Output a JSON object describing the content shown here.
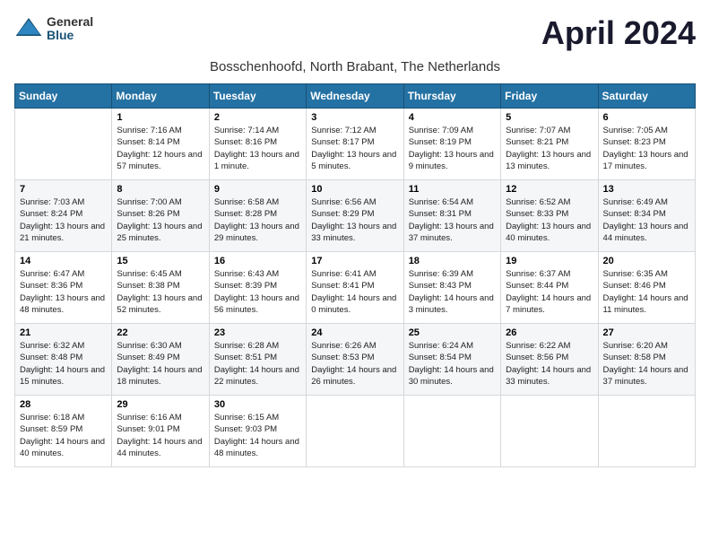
{
  "logo": {
    "general": "General",
    "blue": "Blue"
  },
  "title": "April 2024",
  "subtitle": "Bosschenhoofd, North Brabant, The Netherlands",
  "days_of_week": [
    "Sunday",
    "Monday",
    "Tuesday",
    "Wednesday",
    "Thursday",
    "Friday",
    "Saturday"
  ],
  "weeks": [
    [
      {
        "day": "",
        "sunrise": "",
        "sunset": "",
        "daylight": ""
      },
      {
        "day": "1",
        "sunrise": "Sunrise: 7:16 AM",
        "sunset": "Sunset: 8:14 PM",
        "daylight": "Daylight: 12 hours and 57 minutes."
      },
      {
        "day": "2",
        "sunrise": "Sunrise: 7:14 AM",
        "sunset": "Sunset: 8:16 PM",
        "daylight": "Daylight: 13 hours and 1 minute."
      },
      {
        "day": "3",
        "sunrise": "Sunrise: 7:12 AM",
        "sunset": "Sunset: 8:17 PM",
        "daylight": "Daylight: 13 hours and 5 minutes."
      },
      {
        "day": "4",
        "sunrise": "Sunrise: 7:09 AM",
        "sunset": "Sunset: 8:19 PM",
        "daylight": "Daylight: 13 hours and 9 minutes."
      },
      {
        "day": "5",
        "sunrise": "Sunrise: 7:07 AM",
        "sunset": "Sunset: 8:21 PM",
        "daylight": "Daylight: 13 hours and 13 minutes."
      },
      {
        "day": "6",
        "sunrise": "Sunrise: 7:05 AM",
        "sunset": "Sunset: 8:23 PM",
        "daylight": "Daylight: 13 hours and 17 minutes."
      }
    ],
    [
      {
        "day": "7",
        "sunrise": "Sunrise: 7:03 AM",
        "sunset": "Sunset: 8:24 PM",
        "daylight": "Daylight: 13 hours and 21 minutes."
      },
      {
        "day": "8",
        "sunrise": "Sunrise: 7:00 AM",
        "sunset": "Sunset: 8:26 PM",
        "daylight": "Daylight: 13 hours and 25 minutes."
      },
      {
        "day": "9",
        "sunrise": "Sunrise: 6:58 AM",
        "sunset": "Sunset: 8:28 PM",
        "daylight": "Daylight: 13 hours and 29 minutes."
      },
      {
        "day": "10",
        "sunrise": "Sunrise: 6:56 AM",
        "sunset": "Sunset: 8:29 PM",
        "daylight": "Daylight: 13 hours and 33 minutes."
      },
      {
        "day": "11",
        "sunrise": "Sunrise: 6:54 AM",
        "sunset": "Sunset: 8:31 PM",
        "daylight": "Daylight: 13 hours and 37 minutes."
      },
      {
        "day": "12",
        "sunrise": "Sunrise: 6:52 AM",
        "sunset": "Sunset: 8:33 PM",
        "daylight": "Daylight: 13 hours and 40 minutes."
      },
      {
        "day": "13",
        "sunrise": "Sunrise: 6:49 AM",
        "sunset": "Sunset: 8:34 PM",
        "daylight": "Daylight: 13 hours and 44 minutes."
      }
    ],
    [
      {
        "day": "14",
        "sunrise": "Sunrise: 6:47 AM",
        "sunset": "Sunset: 8:36 PM",
        "daylight": "Daylight: 13 hours and 48 minutes."
      },
      {
        "day": "15",
        "sunrise": "Sunrise: 6:45 AM",
        "sunset": "Sunset: 8:38 PM",
        "daylight": "Daylight: 13 hours and 52 minutes."
      },
      {
        "day": "16",
        "sunrise": "Sunrise: 6:43 AM",
        "sunset": "Sunset: 8:39 PM",
        "daylight": "Daylight: 13 hours and 56 minutes."
      },
      {
        "day": "17",
        "sunrise": "Sunrise: 6:41 AM",
        "sunset": "Sunset: 8:41 PM",
        "daylight": "Daylight: 14 hours and 0 minutes."
      },
      {
        "day": "18",
        "sunrise": "Sunrise: 6:39 AM",
        "sunset": "Sunset: 8:43 PM",
        "daylight": "Daylight: 14 hours and 3 minutes."
      },
      {
        "day": "19",
        "sunrise": "Sunrise: 6:37 AM",
        "sunset": "Sunset: 8:44 PM",
        "daylight": "Daylight: 14 hours and 7 minutes."
      },
      {
        "day": "20",
        "sunrise": "Sunrise: 6:35 AM",
        "sunset": "Sunset: 8:46 PM",
        "daylight": "Daylight: 14 hours and 11 minutes."
      }
    ],
    [
      {
        "day": "21",
        "sunrise": "Sunrise: 6:32 AM",
        "sunset": "Sunset: 8:48 PM",
        "daylight": "Daylight: 14 hours and 15 minutes."
      },
      {
        "day": "22",
        "sunrise": "Sunrise: 6:30 AM",
        "sunset": "Sunset: 8:49 PM",
        "daylight": "Daylight: 14 hours and 18 minutes."
      },
      {
        "day": "23",
        "sunrise": "Sunrise: 6:28 AM",
        "sunset": "Sunset: 8:51 PM",
        "daylight": "Daylight: 14 hours and 22 minutes."
      },
      {
        "day": "24",
        "sunrise": "Sunrise: 6:26 AM",
        "sunset": "Sunset: 8:53 PM",
        "daylight": "Daylight: 14 hours and 26 minutes."
      },
      {
        "day": "25",
        "sunrise": "Sunrise: 6:24 AM",
        "sunset": "Sunset: 8:54 PM",
        "daylight": "Daylight: 14 hours and 30 minutes."
      },
      {
        "day": "26",
        "sunrise": "Sunrise: 6:22 AM",
        "sunset": "Sunset: 8:56 PM",
        "daylight": "Daylight: 14 hours and 33 minutes."
      },
      {
        "day": "27",
        "sunrise": "Sunrise: 6:20 AM",
        "sunset": "Sunset: 8:58 PM",
        "daylight": "Daylight: 14 hours and 37 minutes."
      }
    ],
    [
      {
        "day": "28",
        "sunrise": "Sunrise: 6:18 AM",
        "sunset": "Sunset: 8:59 PM",
        "daylight": "Daylight: 14 hours and 40 minutes."
      },
      {
        "day": "29",
        "sunrise": "Sunrise: 6:16 AM",
        "sunset": "Sunset: 9:01 PM",
        "daylight": "Daylight: 14 hours and 44 minutes."
      },
      {
        "day": "30",
        "sunrise": "Sunrise: 6:15 AM",
        "sunset": "Sunset: 9:03 PM",
        "daylight": "Daylight: 14 hours and 48 minutes."
      },
      {
        "day": "",
        "sunrise": "",
        "sunset": "",
        "daylight": ""
      },
      {
        "day": "",
        "sunrise": "",
        "sunset": "",
        "daylight": ""
      },
      {
        "day": "",
        "sunrise": "",
        "sunset": "",
        "daylight": ""
      },
      {
        "day": "",
        "sunrise": "",
        "sunset": "",
        "daylight": ""
      }
    ]
  ]
}
